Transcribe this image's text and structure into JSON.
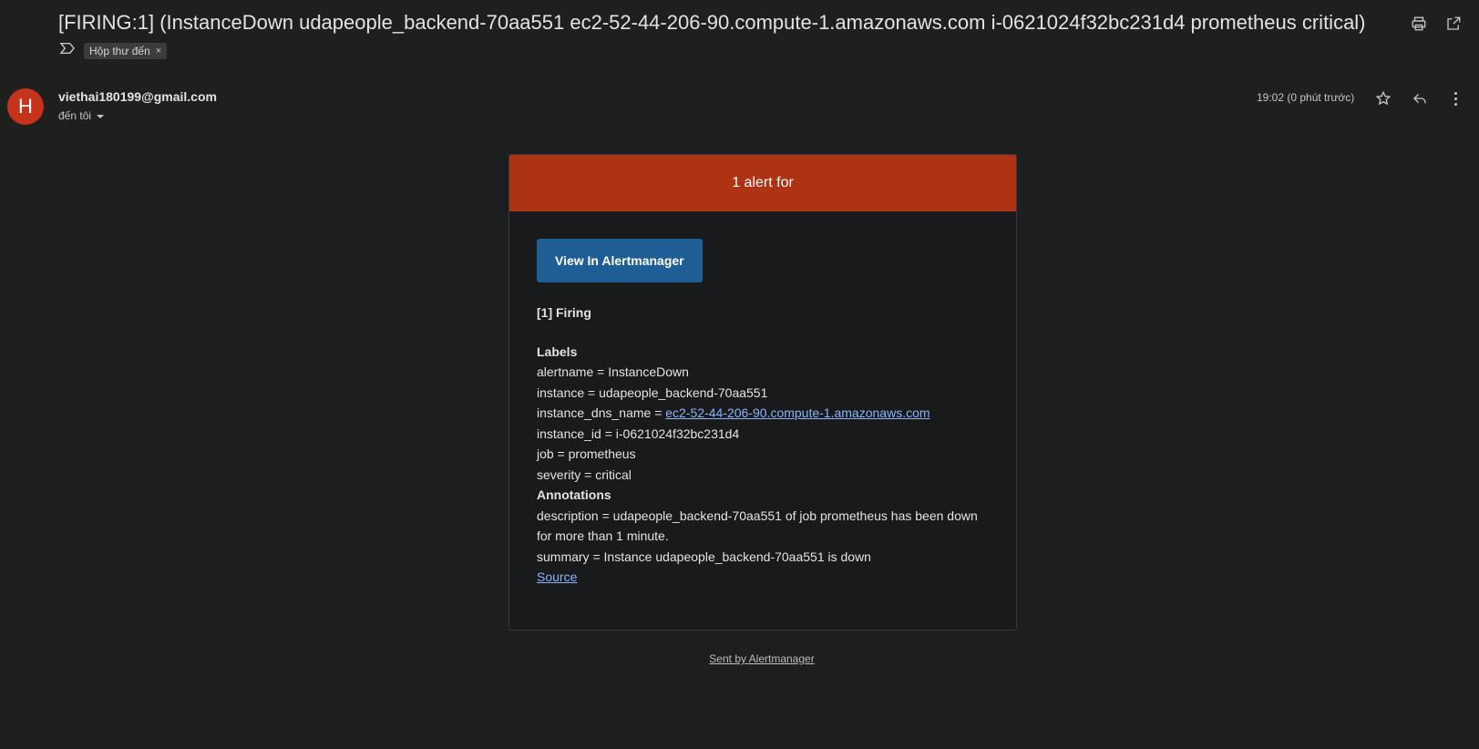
{
  "subject": "[FIRING:1] (InstanceDown udapeople_backend-70aa551 ec2-52-44-206-90.compute-1.amazonaws.com i-0621024f32bc231d4 prometheus critical)",
  "label_chip": "Hộp thư đến",
  "label_chip_close": "×",
  "avatar_letter": "H",
  "sender": "viethai180199@gmail.com",
  "to_label": "đến tôi",
  "time": "19:02 (0 phút trước)",
  "email": {
    "header": "1 alert for",
    "button_label": "View In Alertmanager",
    "firing_title": "[1] Firing",
    "labels_title": "Labels",
    "labels": {
      "alertname": "alertname = InstanceDown",
      "instance": "instance = udapeople_backend-70aa551",
      "dns_prefix": "instance_dns_name = ",
      "dns_link": "ec2-52-44-206-90.compute-1.amazonaws.com",
      "instance_id": "instance_id = i-0621024f32bc231d4",
      "job": "job = prometheus",
      "severity": "severity = critical"
    },
    "annotations_title": "Annotations",
    "annotations": {
      "description_line1": "description = udapeople_backend-70aa551 of job prometheus has been down",
      "description_line2": "for more than 1 minute.",
      "summary": "summary = Instance udapeople_backend-70aa551 is down"
    },
    "source_link": "Source",
    "footer": "Sent by Alertmanager"
  },
  "colors": {
    "header_red": "#ae3315",
    "button_blue": "#1f5e94",
    "avatar": "#c5331b",
    "link": "#8ab4f8"
  }
}
